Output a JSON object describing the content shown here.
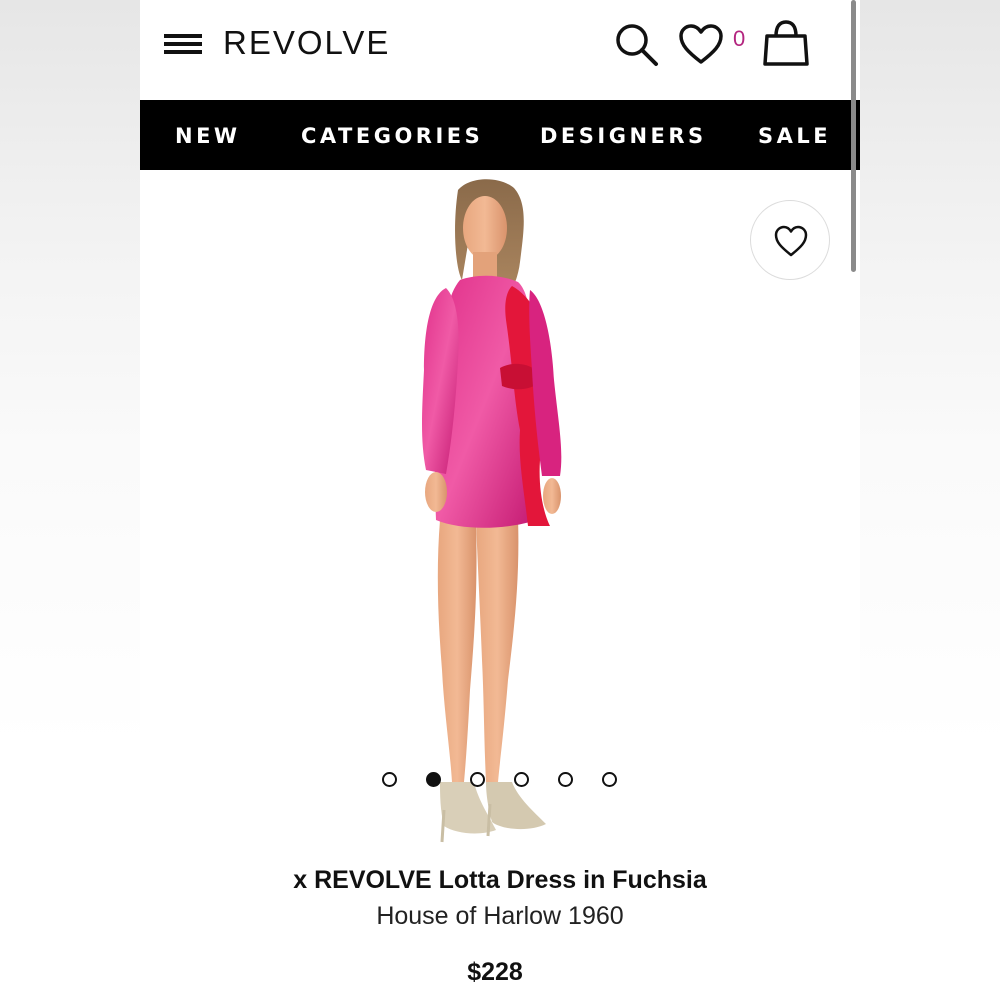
{
  "header": {
    "logo_text": "REVOLVE",
    "wishlist_count": "0",
    "icons": [
      "hamburger-menu-icon",
      "search-icon",
      "heart-icon",
      "shopping-bag-icon"
    ]
  },
  "nav": {
    "items": [
      {
        "label": "NEW"
      },
      {
        "label": "CATEGORIES"
      },
      {
        "label": "DESIGNERS"
      },
      {
        "label": "SALE"
      }
    ]
  },
  "gallery": {
    "image_count": 6,
    "active_index": 1,
    "favorite_icon": "heart-outline-icon"
  },
  "product": {
    "title": "x REVOLVE Lotta Dress in Fuchsia",
    "brand": "House of Harlow 1960",
    "price": "$228"
  },
  "colors": {
    "nav_background": "#000000",
    "nav_text": "#ffffff",
    "wishlist_count": "#b3257f",
    "dress_fuchsia": "#d6207a",
    "dress_red": "#e3163a"
  }
}
